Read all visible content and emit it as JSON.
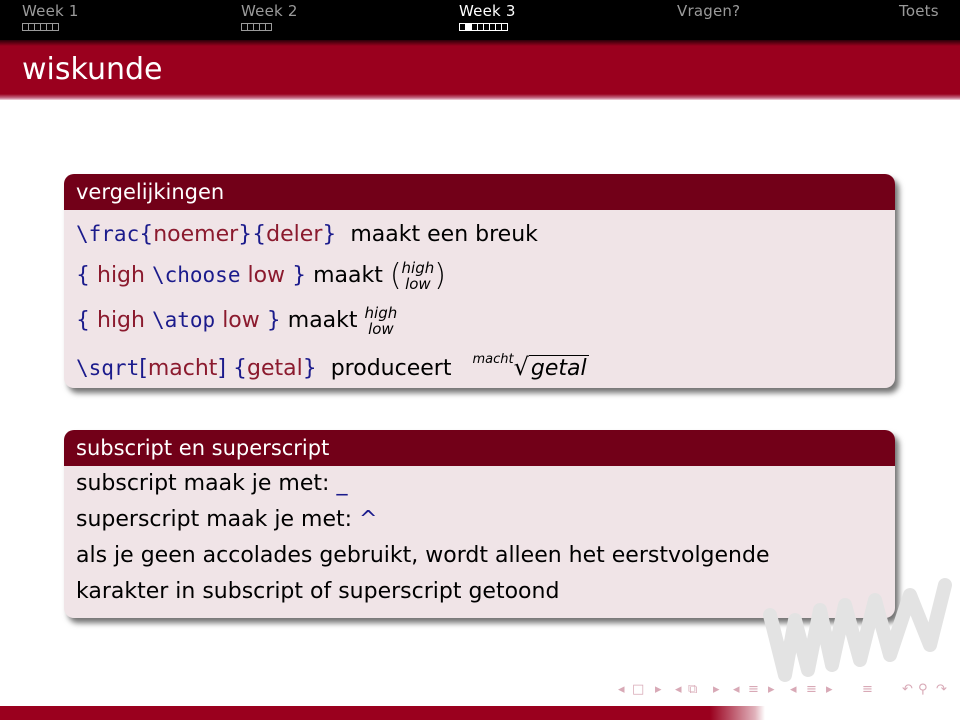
{
  "nav": {
    "sections": [
      {
        "label": "Week 1",
        "slides": 6,
        "current_slide": null,
        "active": false
      },
      {
        "label": "Week 2",
        "slides": 5,
        "current_slide": null,
        "active": false
      },
      {
        "label": "Week 3",
        "slides": 8,
        "current_slide": 2,
        "active": true
      },
      {
        "label": "Vragen?",
        "slides": 0,
        "current_slide": null,
        "active": false
      },
      {
        "label": "Toets",
        "slides": 0,
        "current_slide": null,
        "active": false
      }
    ]
  },
  "slide": {
    "title": "wiskunde"
  },
  "block1": {
    "heading": "vergelijkingen",
    "line1": {
      "cmd": "\\frac",
      "ob1": "{",
      "arg1": "noemer",
      "cb1": "}",
      "ob2": "{",
      "arg2": "deler",
      "cb2": "}",
      "text": "maakt een breuk"
    },
    "line2": {
      "ob": "{",
      "arg1": "high",
      "cmd": "\\choose",
      "arg2": "low",
      "cb": "}",
      "text": "maakt",
      "lp": "(",
      "top": "high",
      "bottom": "low",
      "rp": ")"
    },
    "line3": {
      "ob": "{",
      "arg1": "high",
      "cmd": "\\atop",
      "arg2": "low",
      "cb": "}",
      "text": "maakt",
      "top": "high",
      "bottom": "low"
    },
    "line4": {
      "cmd": "\\sqrt",
      "ob1": "[",
      "arg1": "macht",
      "cb1": "]",
      "ob2": "{",
      "arg2": "getal",
      "cb2": "}",
      "text": "produceert",
      "index": "macht",
      "radical": "√",
      "radicand": "getal"
    }
  },
  "block2": {
    "heading": "subscript en superscript",
    "line1": {
      "text": "subscript maak je met:",
      "symbol": "_"
    },
    "line2": {
      "text": "superscript maak je met:",
      "symbol": "^"
    },
    "line3": "als je geen accolades gebruikt, wordt alleen het eerstvolgende",
    "line4": "karakter in subscript of superscript getoond"
  },
  "navsymbols": {
    "prev_frame": "◂",
    "frame": "□",
    "next_frame": "▸",
    "prev_sub": "◂",
    "sub": "⧉",
    "next_sub": "▸",
    "prev_section": "◂",
    "section": "≡",
    "next_section": "▸",
    "prev_subsection": "◂",
    "subsection": "≡",
    "next_subsection": "▸",
    "toc": "≡",
    "back": "↶",
    "search": "⚲",
    "forward": "↷"
  },
  "colors": {
    "titlebar": "#9a001e",
    "block_header": "#720018",
    "block_body": "#f0e4e7",
    "command": "#1b1b8c",
    "argument": "#8b1a2e"
  }
}
